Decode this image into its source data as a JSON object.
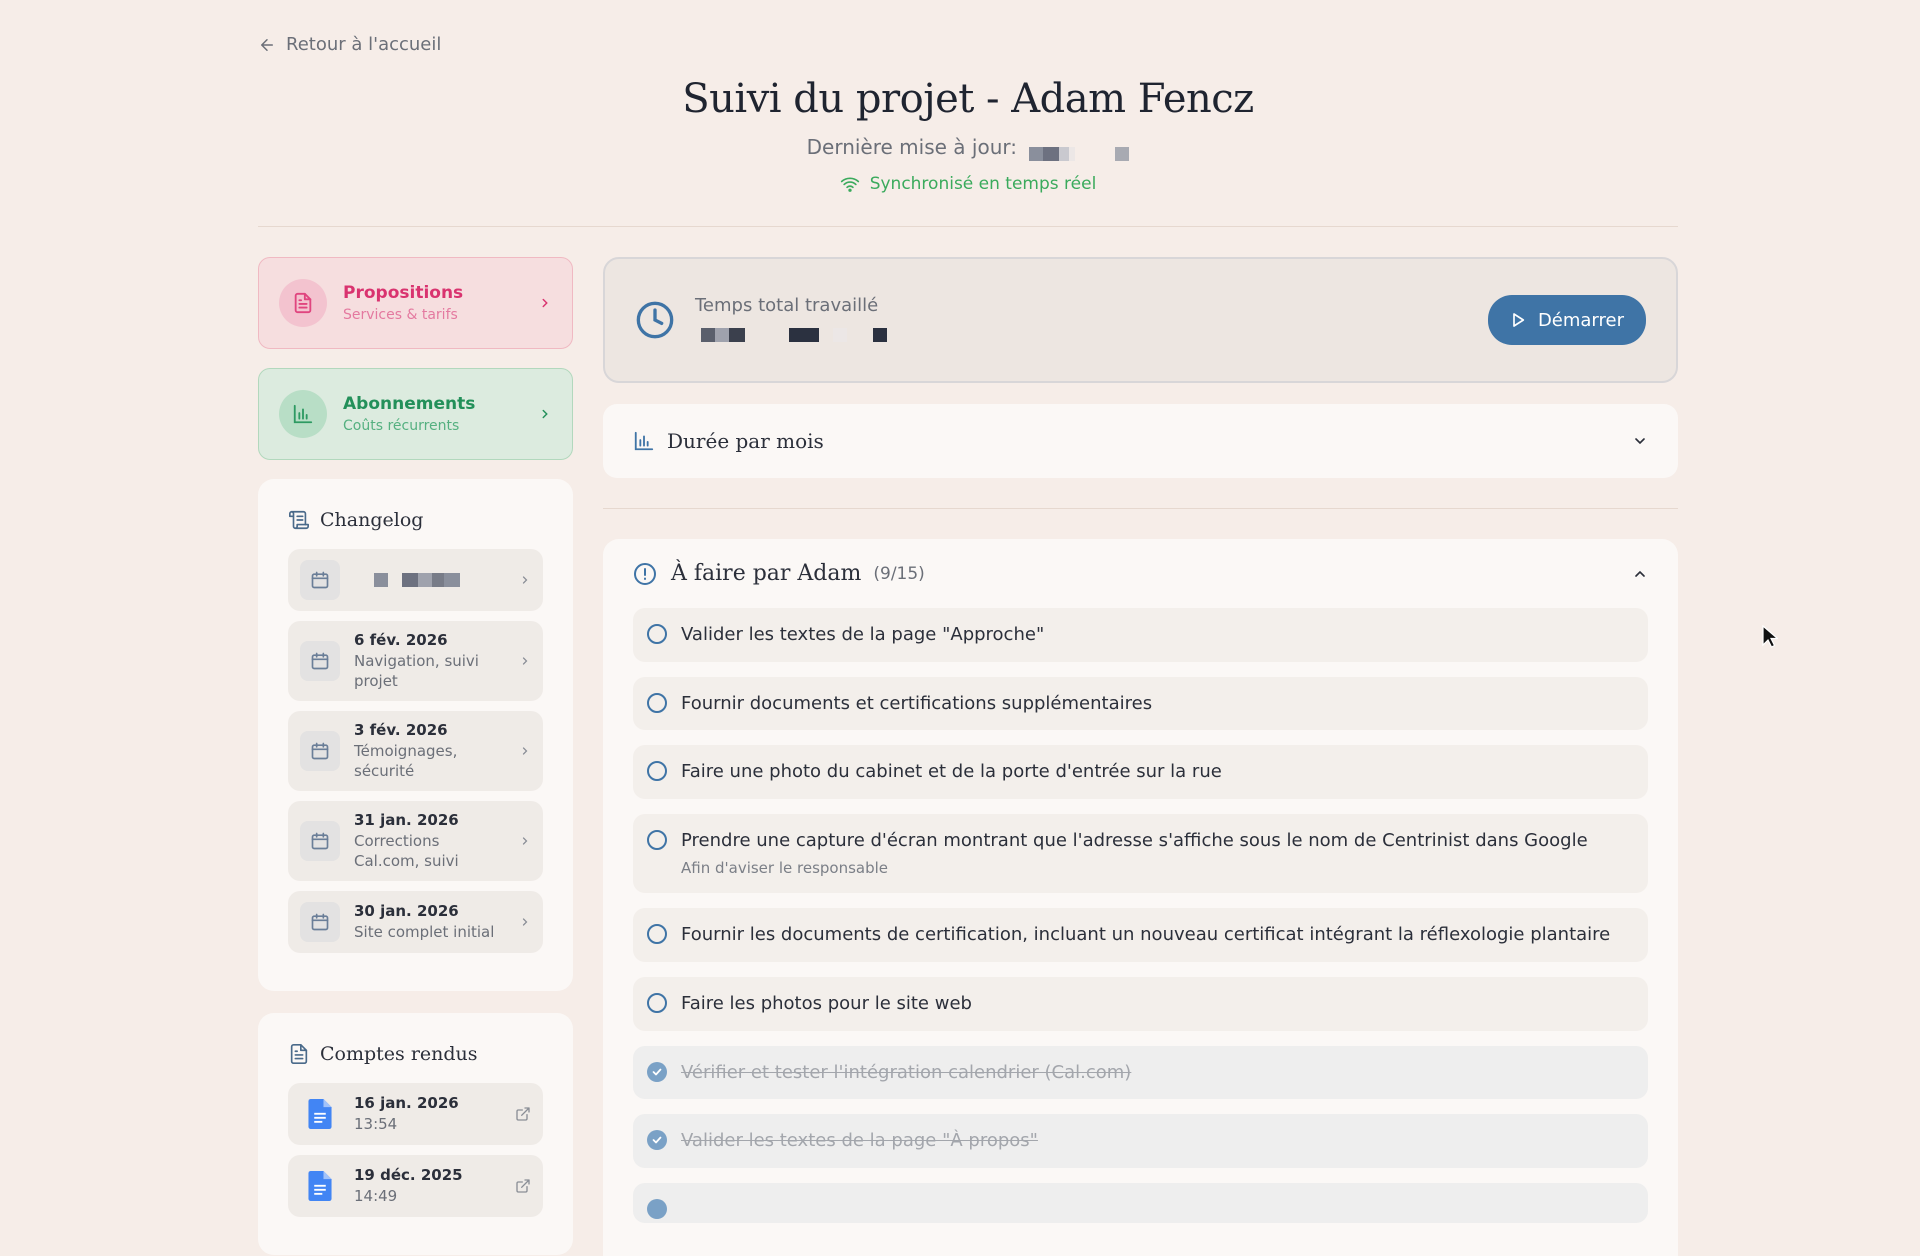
{
  "header": {
    "back_label": "Retour à l'accueil",
    "title": "Suivi du projet - Adam Fencz",
    "updated_label": "Dernière mise à jour:",
    "sync_label": "Synchronisé en temps réel"
  },
  "nav_cards": [
    {
      "title": "Propositions",
      "subtitle": "Services & tarifs"
    },
    {
      "title": "Abonnements",
      "subtitle": "Coûts récurrents"
    }
  ],
  "changelog": {
    "title": "Changelog",
    "items": [
      {
        "date": "6 fév. 2026",
        "desc": "Navigation, suivi projet"
      },
      {
        "date": "3 fév. 2026",
        "desc": "Témoignages, sécurité"
      },
      {
        "date": "31 jan. 2026",
        "desc": "Corrections Cal.com, suivi"
      },
      {
        "date": "30 jan. 2026",
        "desc": "Site complet initial"
      }
    ]
  },
  "reports": {
    "title": "Comptes rendus",
    "items": [
      {
        "date": "16 jan. 2026",
        "time": "13:54"
      },
      {
        "date": "19 déc. 2025",
        "time": "14:49"
      }
    ]
  },
  "timer": {
    "label": "Temps total travaillé",
    "start_label": "Démarrer"
  },
  "monthly": {
    "title": "Durée par mois"
  },
  "todo": {
    "title": "À faire par Adam",
    "count": "(9/15)",
    "tasks": [
      {
        "text": "Valider les textes de la page \"Approche\"",
        "done": false
      },
      {
        "text": "Fournir documents et certifications supplémentaires",
        "done": false
      },
      {
        "text": "Faire une photo du cabinet et de la porte d'entrée sur la rue",
        "done": false
      },
      {
        "text": "Prendre une capture d'écran montrant que l'adresse s'affiche sous le nom de Centrinist dans Google",
        "sub": "Afin d'aviser le responsable",
        "done": false
      },
      {
        "text": "Fournir les documents de certification, incluant un nouveau certificat intégrant la réflexologie plantaire",
        "done": false
      },
      {
        "text": "Faire les photos pour le site web",
        "done": false
      },
      {
        "text": "Vérifier et tester l'intégration calendrier (Cal.com)",
        "done": true
      },
      {
        "text": "Valider les textes de la page \"À propos\"",
        "done": true
      }
    ]
  },
  "colors": {
    "background": "#f6ede8",
    "accent": "#3f74a6",
    "pink": "#d9336f",
    "green": "#23905a",
    "sync_green": "#3aaa5c"
  }
}
